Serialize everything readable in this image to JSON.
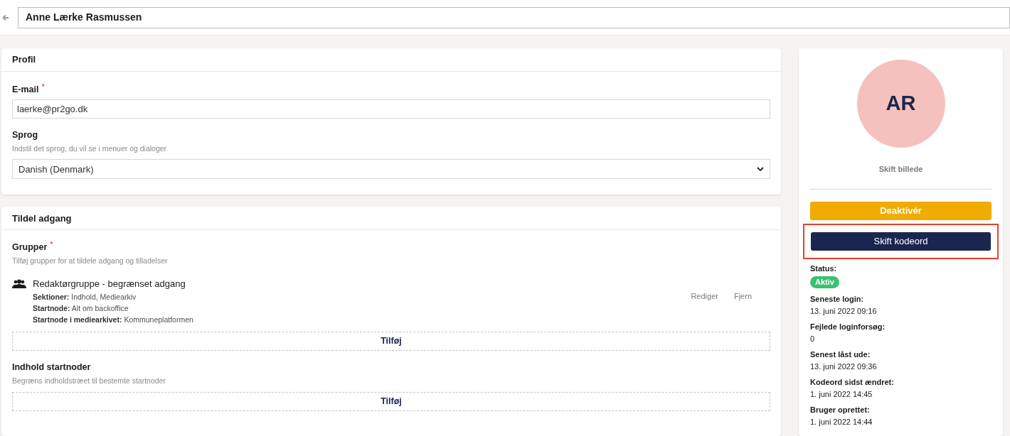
{
  "header": {
    "name": "Anne Lærke Rasmussen"
  },
  "profile": {
    "title": "Profil",
    "email_label": "E-mail",
    "email_required": "*",
    "email": "laerke@pr2go.dk",
    "language_label": "Sprog",
    "language_hint": "Indstil det sprog, du vil se i menuer og dialoger",
    "language": "Danish (Denmark)"
  },
  "access": {
    "title": "Tildel adgang",
    "groups_label": "Grupper",
    "groups_required": "*",
    "groups_hint": "Tilføj grupper for at tildele adgang og tilladelser",
    "groups": [
      {
        "name": "Redaktørgruppe - begrænset adgang",
        "details": [
          "**Sektioner:** Indhold, Mediearkiv",
          "**Startnode:** Alt om backoffice",
          "**Startnode i mediearkivet:** Kommuneplatformen"
        ],
        "actions": [
          "Rediger",
          "Fjern"
        ]
      }
    ],
    "add_label": "Tilføj",
    "nodes_label": "Indhold startnoder",
    "nodes_hint": "Begræns indholdstræet til bestemte startnoder",
    "nodes_add_label": "Tilføj"
  },
  "sidebar": {
    "initials": "AR",
    "change_picture": "Skift billede",
    "buttons": [
      {
        "label": "Deaktivér",
        "kind": "warning",
        "highlighted": false
      },
      {
        "label": "Skift kodeord",
        "kind": "primary",
        "highlighted": true
      }
    ],
    "status_label": "Status:",
    "status": "Aktiv",
    "facts": [
      {
        "label": "Seneste login:",
        "value": "13. juni 2022 09:16"
      },
      {
        "label": "Fejlede loginforsøg:",
        "value": "0"
      },
      {
        "label": "Senest låst ude:",
        "value": "13. juni 2022 09:36"
      },
      {
        "label": "Kodeord sidst ændret:",
        "value": "1. juni 2022 14:45"
      },
      {
        "label": "Bruger oprettet:",
        "value": "1. juni 2022 14:44"
      }
    ]
  }
}
